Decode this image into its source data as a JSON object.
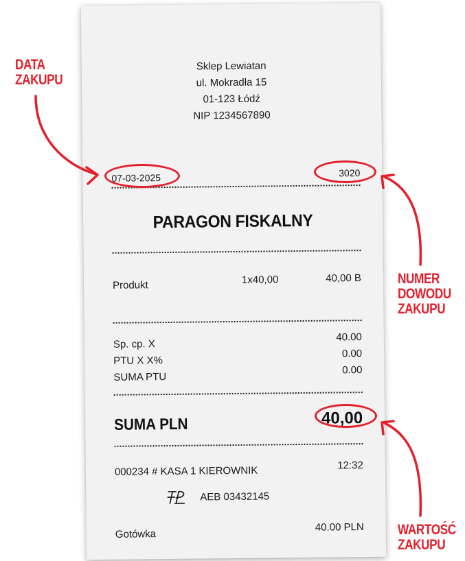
{
  "receipt": {
    "store_name": "Sklep Lewiatan",
    "store_address": "ul. Mokradła 15",
    "store_city": "01-123 Łódź",
    "store_nip": "NIP 1234567890",
    "date": "07-03-2025",
    "receipt_number": "3020",
    "title": "PARAGON FISKALNY",
    "item": {
      "name": "Produkt",
      "qty_price": "1x40,00",
      "total": "40,00 B"
    },
    "tax_lines": [
      {
        "label": "Sp. cp. X",
        "value": "40.00"
      },
      {
        "label": "PTU X X%",
        "value": "0.00"
      },
      {
        "label": "SUMA PTU",
        "value": "0.00"
      }
    ],
    "suma_label": "SUMA PLN",
    "suma_value": "40,00",
    "register_info": "000234 # KASA 1 KIEROWNIK",
    "time": "12:32",
    "fiscal_id": "AEB 03432145",
    "payment_method": "Gotówka",
    "payment_amount": "40.00 PLN"
  },
  "annotations": {
    "purchase_date": [
      "DATA",
      "ZAKUPU"
    ],
    "receipt_number": [
      "NUMER",
      "DOWODU",
      "ZAKUPU"
    ],
    "purchase_value": [
      "WARTOŚĆ",
      "ZAKUPU"
    ]
  },
  "colors": {
    "annotation": "#e4202c",
    "paper": "#f2f2f2",
    "text": "#1a1a1a"
  },
  "icons": {
    "fiscal_logo": "fiscal-pl-logo-icon"
  }
}
